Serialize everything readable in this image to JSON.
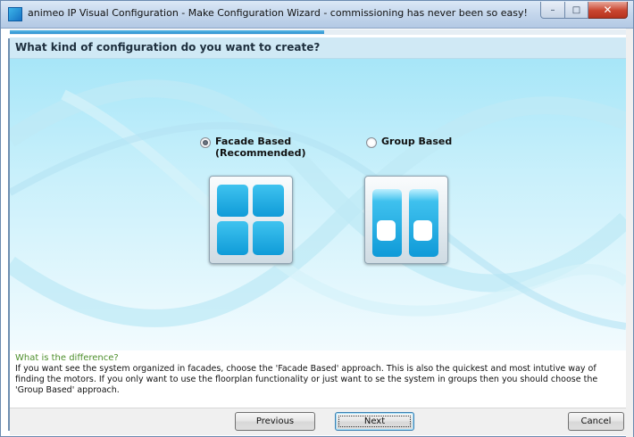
{
  "window": {
    "title": "animeo IP Visual Configuration - Make Configuration Wizard - commissioning has never been so easy!",
    "icons": [
      "app-icon",
      "minimize-icon",
      "maximize-icon",
      "close-icon"
    ]
  },
  "progress": {
    "value": 0.51
  },
  "header": {
    "title": "What kind of configuration do you want to create?"
  },
  "options": [
    {
      "line1": "Facade Based",
      "line2": "(Recommended)",
      "selected": true,
      "icon": "facade-grid-icon"
    },
    {
      "line1": "Group Based",
      "line2": "",
      "selected": false,
      "icon": "group-columns-icon"
    }
  ],
  "info": {
    "title": "What is the difference?",
    "line1": "If you want see the system organized in facades, choose the 'Facade Based' approach. This is also the quickest and most intutive way of",
    "line2": "finding the motors. If you only want to use the floorplan functionality or just want to se the system in groups then you should choose the",
    "line3": "'Group Based' approach."
  },
  "buttons": {
    "previous": "Previous",
    "next": "Next",
    "cancel": "Cancel"
  },
  "colors": {
    "accent": "#1aa3dd",
    "header_bg": "#d0e9f5",
    "info_title": "#4e8f2c"
  }
}
